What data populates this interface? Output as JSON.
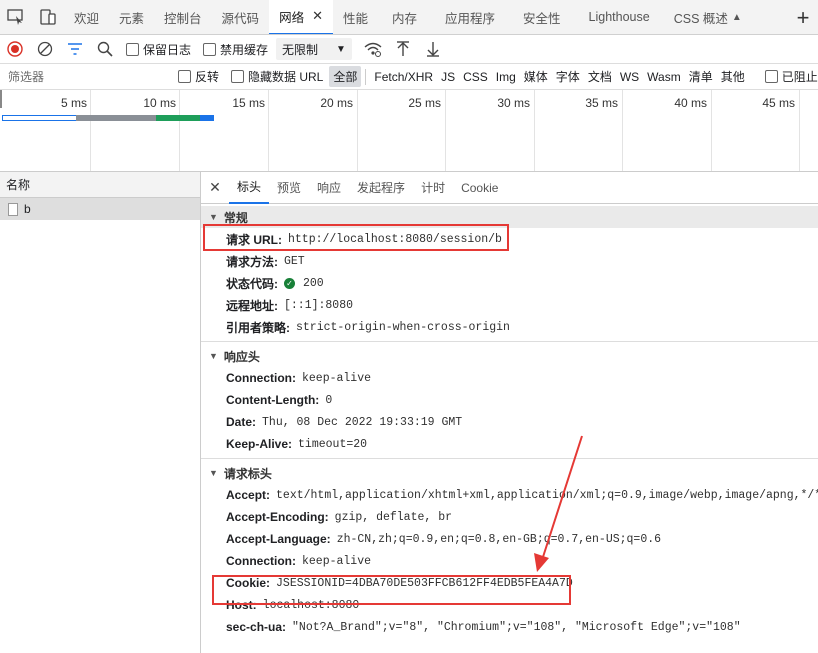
{
  "top_tabs": [
    {
      "label": "欢迎",
      "active": false
    },
    {
      "label": "元素",
      "active": false
    },
    {
      "label": "控制台",
      "active": false
    },
    {
      "label": "源代码",
      "active": false
    },
    {
      "label": "网络",
      "active": true
    },
    {
      "label": "性能",
      "active": false
    },
    {
      "label": "内存",
      "active": false
    },
    {
      "label": "应用程序",
      "active": false
    },
    {
      "label": "安全性",
      "active": false
    },
    {
      "label": "Lighthouse",
      "active": false
    },
    {
      "label": "CSS 概述",
      "active": false
    }
  ],
  "toolbar": {
    "preserve_log": "保留日志",
    "disable_cache": "禁用缓存",
    "throttling": "无限制"
  },
  "filterbar": {
    "placeholder": "筛选器",
    "invert": "反转",
    "hide_data_urls": "隐藏数据 URL",
    "types": [
      "全部",
      "Fetch/XHR",
      "JS",
      "CSS",
      "Img",
      "媒体",
      "字体",
      "文档",
      "WS",
      "Wasm",
      "清单",
      "其他"
    ],
    "selected_type": "全部",
    "blocked": "已阻止"
  },
  "timeline": {
    "ticks": [
      "5 ms",
      "10 ms",
      "15 ms",
      "20 ms",
      "25 ms",
      "30 ms",
      "35 ms",
      "40 ms",
      "45 ms"
    ]
  },
  "request_list": {
    "header": "名称",
    "items": [
      "b"
    ]
  },
  "detail_tabs": [
    "标头",
    "预览",
    "响应",
    "发起程序",
    "计时",
    "Cookie"
  ],
  "active_detail_tab": "标头",
  "general": {
    "title": "常规",
    "rows": [
      {
        "key": "请求 URL:",
        "value": "http://localhost:8080/session/b"
      },
      {
        "key": "请求方法:",
        "value": "GET"
      },
      {
        "key": "状态代码:",
        "value": "200"
      },
      {
        "key": "远程地址:",
        "value": "[::1]:8080"
      },
      {
        "key": "引用者策略:",
        "value": "strict-origin-when-cross-origin"
      }
    ]
  },
  "response_headers": {
    "title": "响应头",
    "rows": [
      {
        "key": "Connection:",
        "value": "keep-alive"
      },
      {
        "key": "Content-Length:",
        "value": "0"
      },
      {
        "key": "Date:",
        "value": "Thu, 08 Dec 2022 19:33:19 GMT"
      },
      {
        "key": "Keep-Alive:",
        "value": "timeout=20"
      }
    ]
  },
  "request_headers": {
    "title": "请求标头",
    "rows": [
      {
        "key": "Accept:",
        "value": "text/html,application/xhtml+xml,application/xml;q=0.9,image/webp,image/apng,*/*;q=0"
      },
      {
        "key": "Accept-Encoding:",
        "value": "gzip, deflate, br"
      },
      {
        "key": "Accept-Language:",
        "value": "zh-CN,zh;q=0.9,en;q=0.8,en-GB;q=0.7,en-US;q=0.6"
      },
      {
        "key": "Connection:",
        "value": "keep-alive"
      },
      {
        "key": "Cookie:",
        "value": "JSESSIONID=4DBA70DE503FFCB612FF4EDB5FEA4A7D"
      },
      {
        "key": "Host:",
        "value": "localhost:8080"
      },
      {
        "key": "sec-ch-ua:",
        "value": "\"Not?A_Brand\";v=\"8\", \"Chromium\";v=\"108\", \"Microsoft Edge\";v=\"108\""
      }
    ]
  },
  "colors": {
    "annotation": "#e53935",
    "accent": "#1a73e8",
    "record": "#d93025",
    "status_ok": "#188038"
  }
}
